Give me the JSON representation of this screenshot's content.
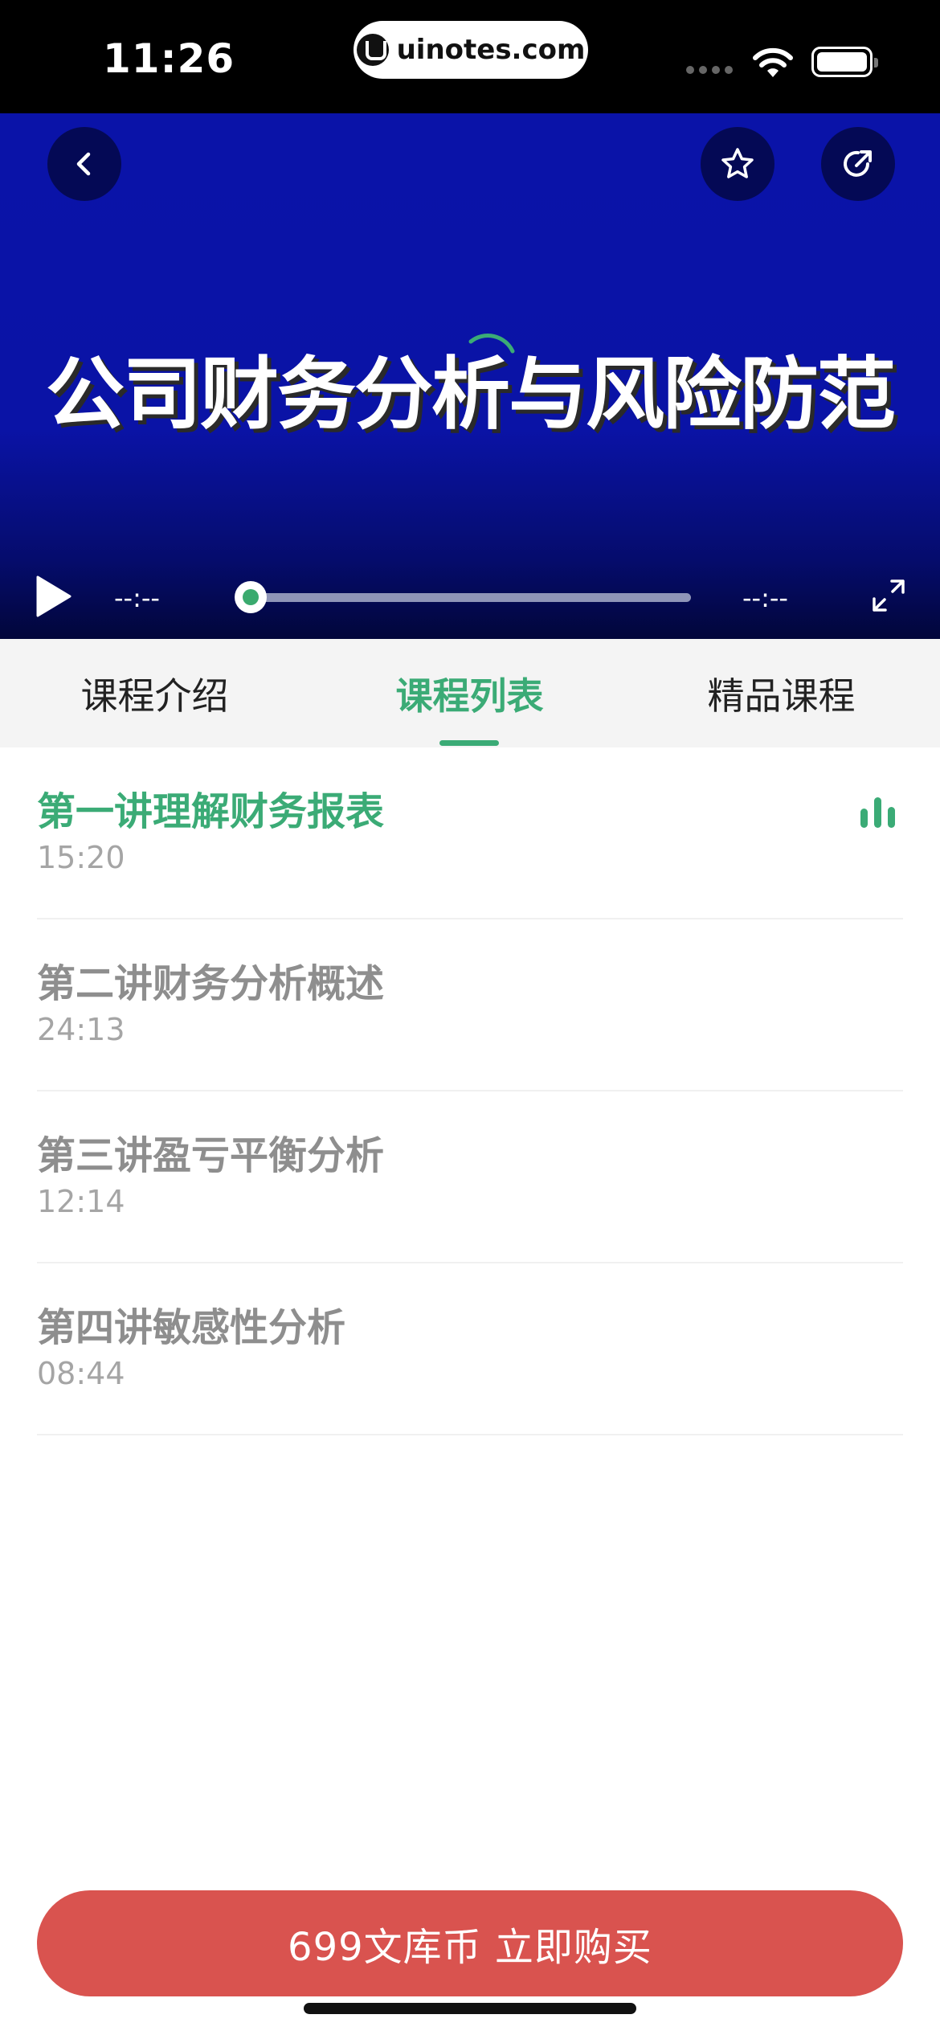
{
  "status_bar": {
    "time": "11:26",
    "url": "uinotes.com"
  },
  "player": {
    "title": "公司财务分析与风险防范",
    "current_time": "--:--",
    "total_time": "--:--",
    "progress": 0,
    "icons": {
      "back": "chevron-left-icon",
      "favorite": "star-icon",
      "share": "share-icon",
      "play": "play-icon",
      "fullscreen": "expand-icon"
    }
  },
  "tabs": [
    {
      "label": "课程介绍",
      "active": false
    },
    {
      "label": "课程列表",
      "active": true
    },
    {
      "label": "精品课程",
      "active": false
    }
  ],
  "lessons": [
    {
      "title": "第一讲理解财务报表",
      "duration": "15:20",
      "active": true
    },
    {
      "title": "第二讲财务分析概述",
      "duration": "24:13",
      "active": false
    },
    {
      "title": "第三讲盈亏平衡分析",
      "duration": "12:14",
      "active": false
    },
    {
      "title": "第四讲敏感性分析",
      "duration": "08:44",
      "active": false
    }
  ],
  "buy_button": {
    "label": "699文库币 立即购买"
  },
  "colors": {
    "accent_green": "#3bab76",
    "buy_red": "#d9534f",
    "player_blue": "#0a13a8"
  }
}
